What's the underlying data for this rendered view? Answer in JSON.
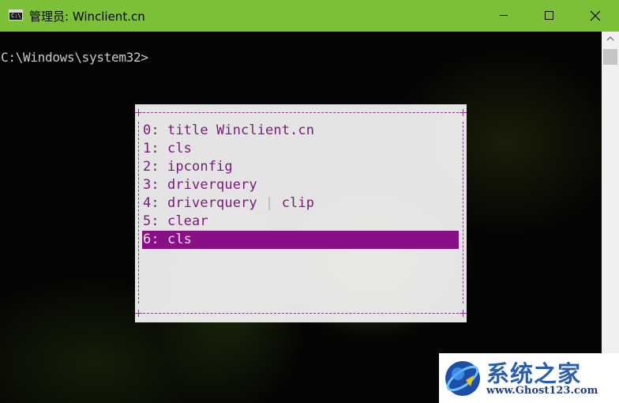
{
  "window": {
    "title": "管理员: Winclient.cn",
    "icon_label": "C:\\_",
    "controls": [
      "minimize-icon",
      "maximize-icon",
      "close-icon"
    ],
    "accent_color": "#7cc038"
  },
  "console": {
    "prompt": "C:\\Windows\\system32>"
  },
  "history_popup": {
    "items": [
      {
        "index": "0:",
        "command": "title Winclient.cn"
      },
      {
        "index": "1:",
        "command": "cls"
      },
      {
        "index": "2:",
        "command": "ipconfig"
      },
      {
        "index": "3:",
        "command": "driverquery"
      },
      {
        "index": "4:",
        "command": "driverquery | clip"
      },
      {
        "index": "5:",
        "command": "clear"
      },
      {
        "index": "6:",
        "command": "cls"
      }
    ],
    "selected_index": 6,
    "text_color": "#7a1a78",
    "highlight_color": "#880f85"
  },
  "watermark": {
    "title": "系统之家",
    "url": "www.Ghost123.com"
  }
}
